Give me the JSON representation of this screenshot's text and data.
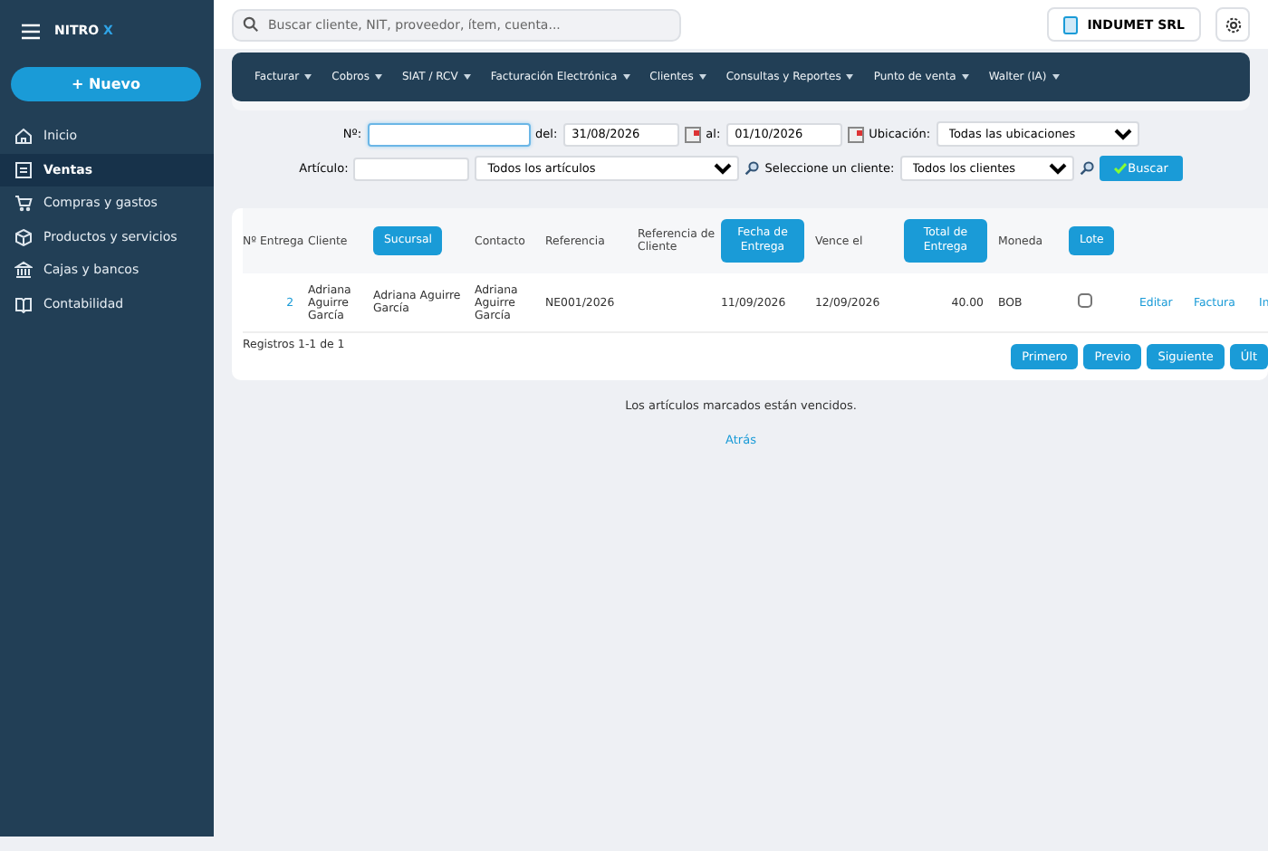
{
  "brand": {
    "name": "NITRO",
    "mark": "X"
  },
  "new_button": "+ Nuevo",
  "sidebar": {
    "items": [
      {
        "label": "Inicio",
        "selected": false
      },
      {
        "label": "Ventas",
        "selected": true
      },
      {
        "label": "Compras y gastos",
        "selected": false
      },
      {
        "label": "Productos y servicios",
        "selected": false
      },
      {
        "label": "Cajas y bancos",
        "selected": false
      },
      {
        "label": "Contabilidad",
        "selected": false
      }
    ]
  },
  "search": {
    "placeholder": "Buscar cliente, NIT, proveedor, ítem, cuenta..."
  },
  "company": "INDUMET SRL",
  "menu": [
    "Facturar",
    "Cobros",
    "SIAT / RCV",
    "Facturación Electrónica",
    "Clientes",
    "Consultas y Reportes",
    "Punto de venta",
    "Walter (IA)"
  ],
  "filters": {
    "number_label": "Nº:",
    "from_label": "del:",
    "from": "31/08/2026",
    "to_label": "al:",
    "to": "01/10/2026",
    "location_label": "Ubicación:",
    "location": "Todas las ubicaciones",
    "article_label": "Artículo:",
    "article": "Todos los artículos",
    "client_label": "Seleccione un cliente:",
    "client": "Todos los clientes",
    "search_button": "Buscar"
  },
  "table": {
    "columns": [
      {
        "label": "Nº Entrega",
        "kind": "text"
      },
      {
        "label": "Cliente",
        "kind": "text"
      },
      {
        "label": "Sucursal",
        "kind": "button"
      },
      {
        "label": "Contacto",
        "kind": "text"
      },
      {
        "label": "Referencia",
        "kind": "text"
      },
      {
        "label": "Referencia de Cliente",
        "kind": "text"
      },
      {
        "label": "Fecha de Entrega",
        "kind": "button"
      },
      {
        "label": "Vence el",
        "kind": "text"
      },
      {
        "label": "Total de Entrega",
        "kind": "button"
      },
      {
        "label": "Moneda",
        "kind": "text"
      },
      {
        "label": "Lote",
        "kind": "button"
      }
    ],
    "rows": [
      {
        "number": "2",
        "client": "Adriana Aguirre García",
        "branch": "Adriana Aguirre García",
        "contact": "Adriana Aguirre García",
        "reference": "NE001/2026",
        "date": "11/09/2026",
        "due": "12/09/2026",
        "total": "40.00",
        "currency": "BOB",
        "checked": false,
        "actions": [
          "Editar",
          "Factura",
          "In"
        ]
      }
    ],
    "records": "Registros 1-1 de 1",
    "pages": [
      "Primero",
      "Previo",
      "Siguiente",
      "Últ"
    ]
  },
  "note": "Los artículos marcados están vencidos.",
  "back_link": "Atrás"
}
